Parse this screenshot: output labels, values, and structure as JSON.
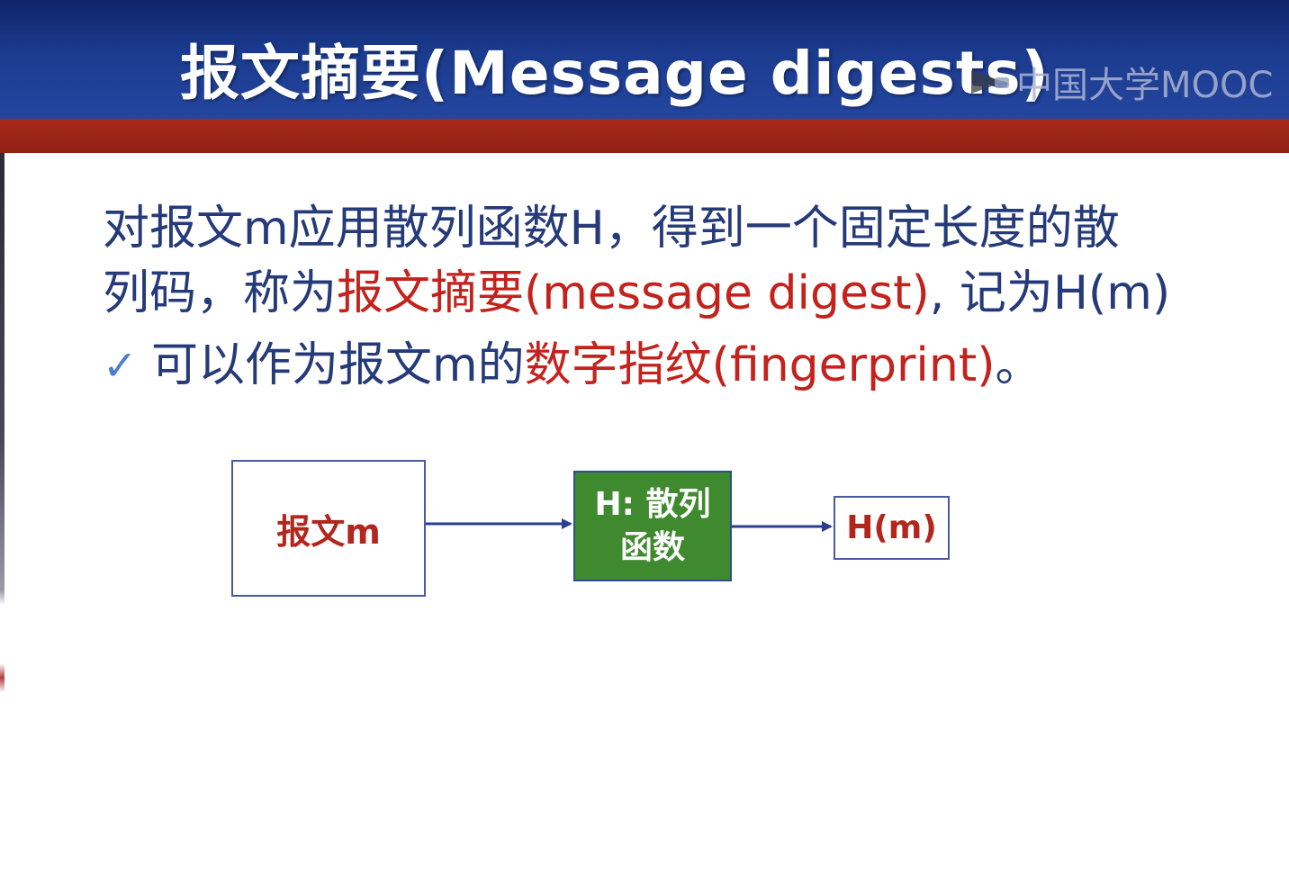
{
  "slide": {
    "title": "报文摘要(Message digests)",
    "watermark": "中国大学MOOC",
    "colors": {
      "header_blue": "#1b3b8e",
      "band_red": "#9a2416",
      "text_blue": "#253a78",
      "text_red": "#c4221c",
      "hash_box_green": "#3f8a2e"
    }
  },
  "paragraph": {
    "line1": "对报文m应用散列函数H，得到一个固定长度的散",
    "line2_pre": "列码，称为",
    "line2_red": "报文摘要(message digest)",
    "line2_post": ", 记为H(m)",
    "check_icon": "check-icon",
    "bullet_pre": "可以作为报文m的",
    "bullet_red": "数字指纹(fingerprint)",
    "bullet_post": "。"
  },
  "diagram": {
    "input_label": "报文m",
    "hash_label": "H: 散列\n函数",
    "output_label": "H(m)"
  }
}
